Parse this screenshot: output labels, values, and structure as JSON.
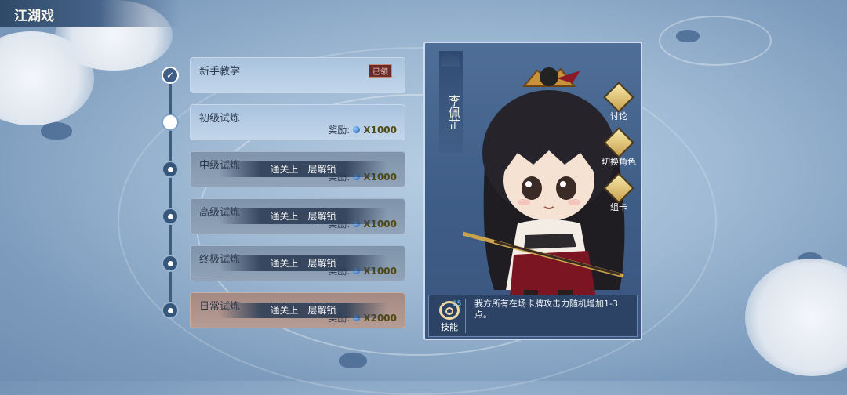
{
  "header": {
    "title": "江湖戏"
  },
  "stages": [
    {
      "name": "新手教学",
      "status": "done",
      "badge": "已领"
    },
    {
      "name": "初级试炼",
      "status": "current",
      "reward_label": "奖励:",
      "reward_amount": "X1000"
    },
    {
      "name": "中级试炼",
      "status": "locked",
      "reward_label": "奖励:",
      "reward_amount": "X1000",
      "lock_text": "通关上一层解锁"
    },
    {
      "name": "高级试炼",
      "status": "locked",
      "reward_label": "奖励:",
      "reward_amount": "X1000",
      "lock_text": "通关上一层解锁"
    },
    {
      "name": "终极试炼",
      "status": "locked",
      "reward_label": "奖励:",
      "reward_amount": "X1000",
      "lock_text": "通关上一层解锁"
    },
    {
      "name": "日常试炼",
      "status": "locked",
      "reward_label": "奖励:",
      "reward_amount": "X2000",
      "lock_text": "通关上一层解锁"
    }
  ],
  "character": {
    "name": "李佩芷",
    "skill": {
      "label": "技能",
      "cost": "15",
      "description": "我方所有在场卡牌攻击力随机增加1-3点。"
    }
  },
  "side_buttons": [
    {
      "label": "讨论",
      "icon": "scroll-icon"
    },
    {
      "label": "切换角色",
      "icon": "switch-character-icon"
    },
    {
      "label": "组卡",
      "icon": "cards-icon"
    }
  ],
  "colors": {
    "panel": "#3e5d86",
    "stage_unlocked": "#c2d6ea",
    "stage_locked": "#90a3b8",
    "stage_daily": "#b59c94",
    "reward_amount": "#4e4a1a",
    "skill_cost": "#6fd3ff"
  }
}
